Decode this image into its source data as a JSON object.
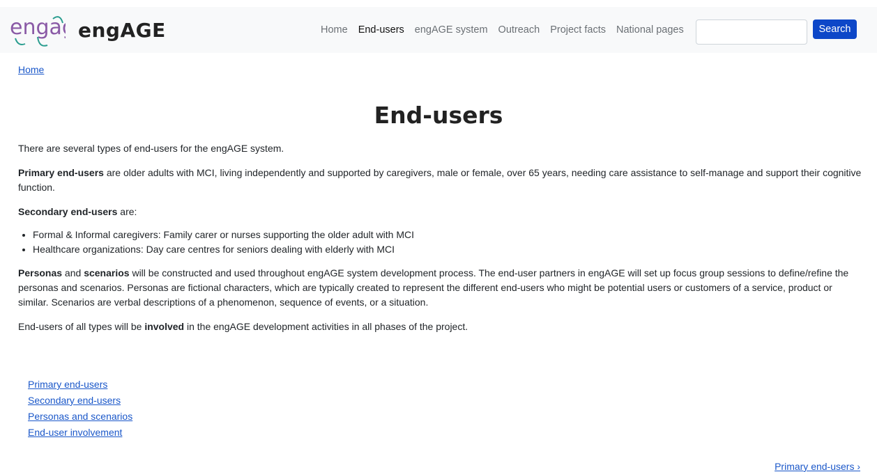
{
  "header": {
    "brand_name": "engAGE",
    "logo_text": "engage",
    "nav": [
      {
        "label": "Home",
        "active": false
      },
      {
        "label": "End-users",
        "active": true
      },
      {
        "label": "engAGE system",
        "active": false
      },
      {
        "label": "Outreach",
        "active": false
      },
      {
        "label": "Project facts",
        "active": false
      },
      {
        "label": "National pages",
        "active": false
      }
    ],
    "search": {
      "value": "",
      "placeholder": "",
      "button_label": "Search"
    }
  },
  "breadcrumb": {
    "home": "Home"
  },
  "page_title": "End-users",
  "content": {
    "intro": "There are several types of end-users for the engAGE system.",
    "primary": {
      "term": "Primary end-users",
      "text": " are older adults with MCI, living independently and supported by caregivers, male or female, over 65 years, needing care assistance to self-manage and support their cognitive function."
    },
    "secondary": {
      "term": "Secondary end-users",
      "text": " are:"
    },
    "secondary_list": [
      "Formal & Informal caregivers: Family carer or nurses supporting the older adult with MCI",
      "Healthcare organizations: Day care centres for seniors dealing with elderly with MCI"
    ],
    "personas": {
      "term1": "Personas",
      "and": " and ",
      "term2": "scenarios",
      "text": " will be constructed and used throughout engAGE system development process. The end-user partners in engAGE will set up focus group sessions to define/refine the personas and scenarios. Personas are fictional characters, which are typically created to represent the different end-users who might be potential users or customers of a service, product or similar. Scenarios are verbal descriptions of a phenomenon, sequence of events, or a situation."
    },
    "involvement": {
      "before": "End-users of all types will be ",
      "term": "involved",
      "after": " in the engAGE development activities in all phases of the project."
    }
  },
  "subnav": [
    "Primary end-users",
    "Secondary end-users",
    "Personas and scenarios",
    "End-user involvement"
  ],
  "next_link": "Primary end-users ›",
  "colors": {
    "accent": "#1a57c9",
    "search_button": "#0d47c8",
    "navbar_bg": "#f8f9fa",
    "logo_purple": "#8a5aa6",
    "logo_teal": "#2a9d8f"
  }
}
